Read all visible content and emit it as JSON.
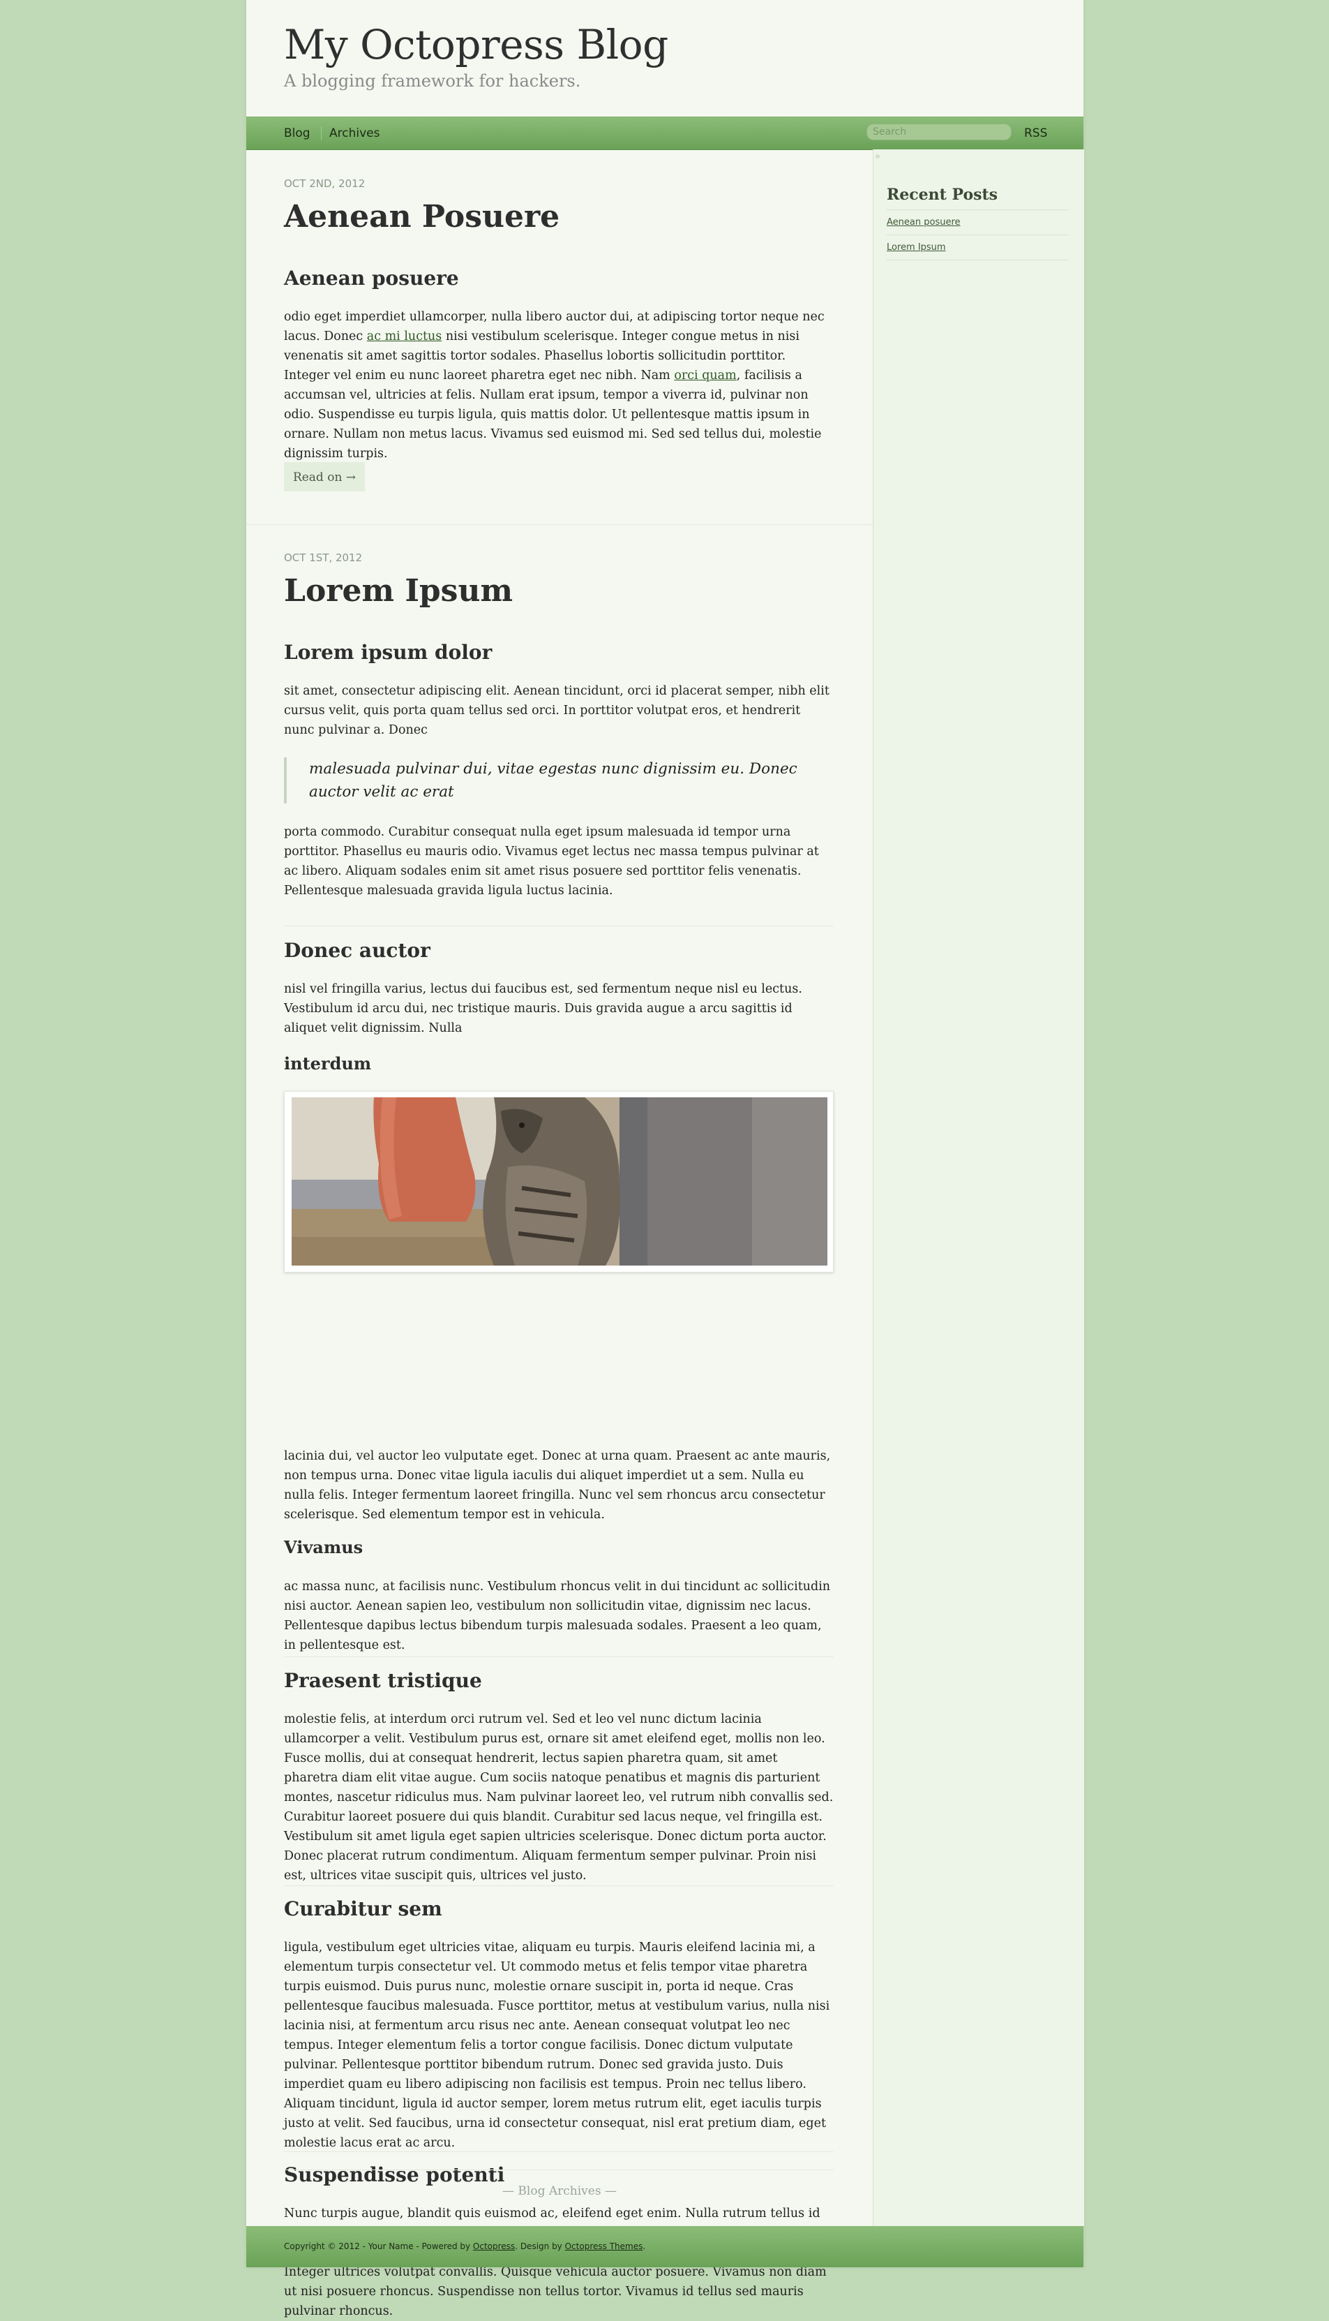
{
  "header": {
    "title": "My Octopress Blog",
    "subtitle": "A blogging framework for hackers."
  },
  "nav": {
    "blog": "Blog",
    "archives": "Archives",
    "search_placeholder": "Search",
    "rss": "RSS"
  },
  "sidebar": {
    "collapse_icon": "»",
    "recent_title": "Recent Posts",
    "recent": [
      "Aenean posuere",
      "Lorem Ipsum"
    ]
  },
  "post1": {
    "date": "Oct 2nd, 2012",
    "title": "Aenean Posuere",
    "h3": "Aenean posuere",
    "p1_a": "odio eget imperdiet ullamcorper, nulla libero auctor dui, at adipiscing tortor neque nec lacus. Donec ",
    "p1_link1": "ac mi luctus",
    "p1_b": " nisi vestibulum scelerisque. Integer congue metus in nisi venenatis sit amet sagittis tortor sodales. Phasellus lobortis sollicitudin porttitor. Integer vel enim eu nunc laoreet pharetra eget nec nibh. Nam ",
    "p1_link2": "orci quam",
    "p1_c": ", facilisis a accumsan vel, ultricies at felis. Nullam erat ipsum, tempor a viverra id, pulvinar non odio. Suspendisse eu turpis ligula, quis mattis dolor. Ut pellentesque mattis ipsum in ornare. Nullam non metus lacus. Vivamus sed euismod mi. Sed sed tellus dui, molestie dignissim turpis.",
    "read_on": "Read on →"
  },
  "post2": {
    "date": "Oct 1st, 2012",
    "title": "Lorem Ipsum",
    "h3_1": "Lorem ipsum dolor",
    "p1": "sit amet, consectetur adipiscing elit. Aenean tincidunt, orci id placerat semper, nibh elit cursus velit, quis porta quam tellus sed orci. In porttitor volutpat eros, et hendrerit nunc pulvinar a. Donec",
    "quote": "malesuada pulvinar dui, vitae egestas nunc dignissim eu. Donec auctor velit ac erat",
    "p2": "porta commodo. Curabitur consequat nulla eget ipsum malesuada id tempor urna porttitor. Phasellus eu mauris odio. Vivamus eget lectus nec massa tempus pulvinar at ac libero. Aliquam sodales enim sit amet risus posuere sed porttitor felis venenatis. Pellentesque malesuada gravida ligula luctus lacinia.",
    "h3_2": "Donec auctor",
    "p3": "nisl vel fringilla varius, lectus dui faucibus est, sed fermentum neque nisl eu lectus. Vestibulum id arcu dui, nec tristique mauris. Duis gravida augue a arcu sagittis id aliquet velit dignissim. Nulla",
    "h4_1": "interdum",
    "p4": "lacinia dui, vel auctor leo vulputate eget. Donec at urna quam. Praesent ac ante mauris, non tempus urna. Donec vitae ligula iaculis dui aliquet imperdiet ut a sem. Nulla eu nulla felis. Integer fermentum laoreet fringilla. Nunc vel sem rhoncus arcu consectetur scelerisque. Sed elementum tempor est in vehicula.",
    "h4_2": "Vivamus",
    "p5": "ac massa nunc, at facilisis nunc. Vestibulum rhoncus velit in dui tincidunt ac sollicitudin nisi auctor. Aenean sapien leo, vestibulum non sollicitudin vitae, dignissim nec lacus. Pellentesque dapibus lectus bibendum turpis malesuada sodales. Praesent a leo quam, in pellentesque est.",
    "h3_3": "Praesent tristique",
    "p6": "molestie felis, at interdum orci rutrum vel. Sed et leo vel nunc dictum lacinia ullamcorper a velit. Vestibulum purus est, ornare sit amet eleifend eget, mollis non leo. Fusce mollis, dui at consequat hendrerit, lectus sapien pharetra quam, sit amet pharetra diam elit vitae augue. Cum sociis natoque penatibus et magnis dis parturient montes, nascetur ridiculus mus. Nam pulvinar laoreet leo, vel rutrum nibh convallis sed. Curabitur laoreet posuere dui quis blandit. Curabitur sed lacus neque, vel fringilla est. Vestibulum sit amet ligula eget sapien ultricies scelerisque. Donec dictum porta auctor. Donec placerat rutrum condimentum. Aliquam fermentum semper pulvinar. Proin nisi est, ultrices vitae suscipit quis, ultrices vel justo.",
    "h3_4": "Curabitur sem",
    "p7": "ligula, vestibulum eget ultricies vitae, aliquam eu turpis. Mauris eleifend lacinia mi, a elementum turpis consectetur vel. Ut commodo metus et felis tempor vitae pharetra turpis euismod. Duis purus nunc, molestie ornare suscipit in, porta id neque. Cras pellentesque faucibus malesuada. Fusce porttitor, metus at vestibulum varius, nulla nisi lacinia nisi, at fermentum arcu risus nec ante. Aenean consequat volutpat leo nec tempus. Integer elementum felis a tortor congue facilisis. Donec dictum vulputate pulvinar. Pellentesque porttitor bibendum rutrum. Donec sed gravida justo. Duis imperdiet quam eu libero adipiscing non facilisis est tempus. Proin nec tellus libero. Aliquam tincidunt, ligula id auctor semper, lorem metus rutrum elit, eget iaculis turpis justo at velit. Sed faucibus, urna id consectetur consequat, nisl erat pretium diam, eget molestie lacus erat ac arcu.",
    "h3_5": "Suspendisse potenti",
    "p8": "Nunc turpis augue, blandit quis euismod ac, eleifend eget enim. Nulla rutrum tellus id magna lobortis fermentum. Aliquam pretium vulputate erat, in mattis justo gravida vel. Aliquam sem volutpat. Nunc sem orci, adipiscing ultrices sagittis at, fringilla nec ipsum. Integer ultrices volutpat convallis. Quisque vehicula auctor posuere. Vivamus non diam ut nisi posuere rhoncus. Suspendisse non tellus tortor. Vivamus id tellus sed mauris pulvinar rhoncus."
  },
  "archives_link": "— Blog Archives —",
  "footer": {
    "prefix": "Copyright © 2012 - Your Name - Powered by ",
    "octopress": "Octopress",
    "middle": ". Design by ",
    "themes": "Octopress Themes",
    "suffix": "."
  }
}
